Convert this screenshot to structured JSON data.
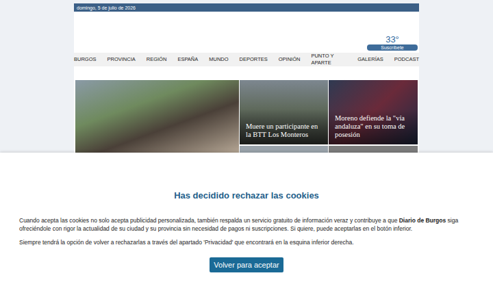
{
  "top_bar": {
    "date": "domingo, 5 de julio de 2026"
  },
  "header": {
    "weather": "33°",
    "subscribe_button": "Suscríbete"
  },
  "nav": {
    "items": [
      {
        "label": "BURGOS"
      },
      {
        "label": "PROVINCIA"
      },
      {
        "label": "REGIÓN"
      },
      {
        "label": "ESPAÑA"
      },
      {
        "label": "MUNDO"
      },
      {
        "label": "DEPORTES"
      },
      {
        "label": "OPINIÓN"
      },
      {
        "label": "PUNTO Y APARTE"
      },
      {
        "label": "GALERÍAS"
      },
      {
        "label": "PODCAST"
      }
    ]
  },
  "stories": [
    {
      "caption": ""
    },
    {
      "caption": "Muere un participante en la BTT Los Monteros"
    },
    {
      "caption": "Moreno defiende la \"vía andaluza\" en su toma de posesión"
    }
  ],
  "cookie_dialog": {
    "title": "Has decidido rechazar las cookies",
    "paragraphs": [
      {
        "parts": [
          {
            "text": "Cuando acepta las cookies no solo acepta publicidad personalizada, también respalda un servicio gratuito de información veraz y contribuye a que ",
            "bold": false
          },
          {
            "text": "Diario de Burgos",
            "bold": true
          },
          {
            "text": " siga ofreciéndole con rigor la actualidad de su ciudad y su provincia sin necesidad de pagos ni suscripciones. Si quiere, puede aceptarlas en el botón inferior.",
            "bold": false
          }
        ]
      },
      {
        "parts": [
          {
            "text": "Siempre tendrá la opción de volver a rechazarlas a través del apartado 'Privacidad' que encontrará en la esquina inferior derecha.",
            "bold": false
          }
        ]
      }
    ],
    "button": "Volver para aceptar"
  }
}
